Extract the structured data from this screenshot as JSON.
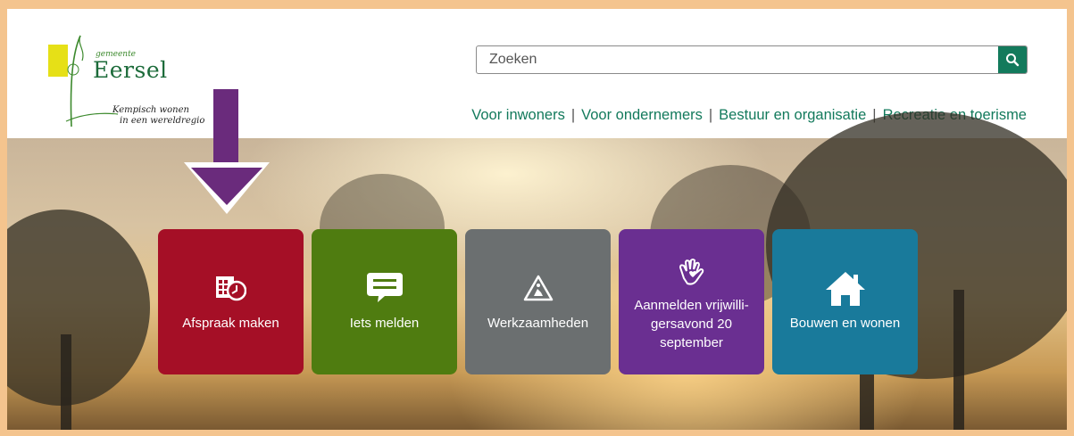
{
  "logo": {
    "small_text": "gemeente",
    "name": "Eersel",
    "tagline_1": "Kempisch wonen",
    "tagline_2": "in een wereldregio"
  },
  "search": {
    "placeholder": "Zoeken",
    "icon": "search-icon"
  },
  "nav": {
    "items": [
      "Voor inwoners",
      "Voor ondernemers",
      "Bestuur en organisatie",
      "Recreatie en toerisme"
    ],
    "separator": "|"
  },
  "tiles": [
    {
      "label": "Afspraak maken",
      "icon": "calendar-clock-icon",
      "color": "#a50f26"
    },
    {
      "label": "Iets melden",
      "icon": "speech-bubble-icon",
      "color": "#4f7c10"
    },
    {
      "label": "Werkzaamheden",
      "icon": "roadwork-sign-icon",
      "color": "#6b6f70"
    },
    {
      "label": "Aanmelden vrijwilli-gersavond 20 september",
      "icon": "helping-hands-icon",
      "color": "#6a2f91"
    },
    {
      "label": "Bouwen en wonen",
      "icon": "house-icon",
      "color": "#197a9b"
    }
  ],
  "colors": {
    "brand_green": "#137a5c",
    "frame": "#f4c48e",
    "arrow": "#6a2b7c"
  }
}
